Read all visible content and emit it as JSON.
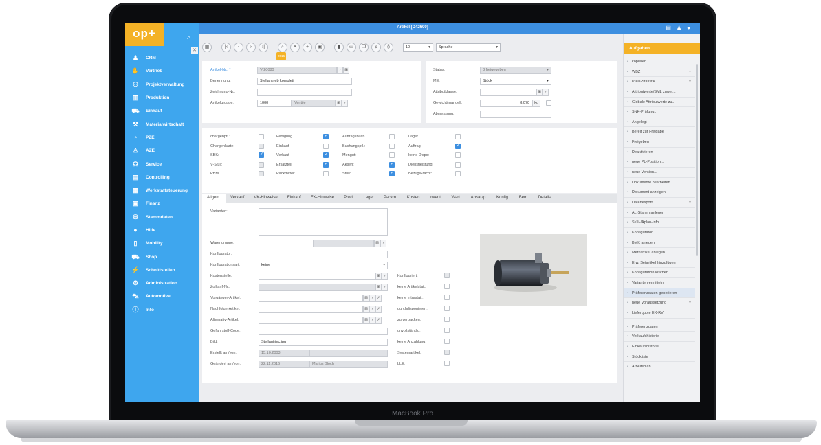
{
  "device": {
    "brand": "MacBook Pro"
  },
  "window": {
    "title": "Artikel [D42600]"
  },
  "logo": "op+",
  "sidebar": {
    "items": [
      {
        "label": "CRM",
        "icon": "people-icon"
      },
      {
        "label": "Vertrieb",
        "icon": "handshake-icon"
      },
      {
        "label": "Projektverwaltung",
        "icon": "org-chart-icon"
      },
      {
        "label": "Produktion",
        "icon": "factory-icon"
      },
      {
        "label": "Einkauf",
        "icon": "cart-icon"
      },
      {
        "label": "Materialwirtschaft",
        "icon": "forklift-icon"
      },
      {
        "label": "PZE",
        "icon": "clock-user-icon"
      },
      {
        "label": "AZE",
        "icon": "user-icon"
      },
      {
        "label": "Service",
        "icon": "headset-icon"
      },
      {
        "label": "Controlling",
        "icon": "chart-icon"
      },
      {
        "label": "Werkstattsteuerung",
        "icon": "grid-icon"
      },
      {
        "label": "Finanz",
        "icon": "calculator-icon"
      },
      {
        "label": "Stammdaten",
        "icon": "database-icon"
      },
      {
        "label": "Hilfe",
        "icon": "lightbulb-icon"
      },
      {
        "label": "Mobility",
        "icon": "phone-icon"
      },
      {
        "label": "Shop",
        "icon": "shop-cart-icon"
      },
      {
        "label": "Schnittstellen",
        "icon": "plug-icon"
      },
      {
        "label": "Administration",
        "icon": "admin-icon"
      },
      {
        "label": "Automotive",
        "icon": "car-icon"
      },
      {
        "label": "Info",
        "icon": "info-icon"
      }
    ]
  },
  "toolbar": {
    "year_badge": "2016",
    "size_value": "10",
    "language_value": "Sprache"
  },
  "header_form": {
    "artikel_label": "Artikel-Nr.: *",
    "artikel_value": "V-20080",
    "benennung_label": "Benennung:",
    "benennung_value": "Stellantrieb komplett",
    "zeichnung_label": "Zeichnung-Nr.:",
    "zeichnung_value": "",
    "artikelgruppe_label": "Artikelgruppe:",
    "artikelgruppe_value": "1000",
    "artikelgruppe_name": "Ventile",
    "status_label": "Status:",
    "status_value": "3 freigegeben",
    "me_label": "ME:",
    "me_value": "Stück",
    "attributklasse_label": "Attributklasse:",
    "attributklasse_value": "",
    "gewicht_label": "Gewicht/manuell:",
    "gewicht_value": "8,070",
    "gewicht_unit": "kg",
    "abmessung_label": "Abmessung:",
    "abmessung_value": ""
  },
  "flags": [
    {
      "label": "chargenpfl.:",
      "state": "off"
    },
    {
      "label": "Fertigung",
      "state": "on"
    },
    {
      "label": "Auftragsbuch.:",
      "state": "off"
    },
    {
      "label": "Lager",
      "state": "off"
    },
    {
      "label": "Chargenkarte:",
      "state": "dis"
    },
    {
      "label": "Einkauf",
      "state": "off"
    },
    {
      "label": "Buchungspfl.:",
      "state": "off"
    },
    {
      "label": "Auftrag",
      "state": "on"
    },
    {
      "label": "SBK:",
      "state": "on"
    },
    {
      "label": "Verkauf",
      "state": "on"
    },
    {
      "label": "Mengut:",
      "state": "off"
    },
    {
      "label": "keine Dispo:",
      "state": "off"
    },
    {
      "label": "V-Stüli:",
      "state": "dis"
    },
    {
      "label": "Ersatzteil",
      "state": "on"
    },
    {
      "label": "Aktien:",
      "state": "on"
    },
    {
      "label": "Dienstleistung:",
      "state": "off"
    },
    {
      "label": "PBM:",
      "state": "dis"
    },
    {
      "label": "Packmittel:",
      "state": "off"
    },
    {
      "label": "Stüli:",
      "state": "on"
    },
    {
      "label": "Bezug/Fracht:",
      "state": "off"
    }
  ],
  "tabs": [
    "Allgem.",
    "Verkauf",
    "VK-Hinweise",
    "Einkauf",
    "EK-Hinweise",
    "Prod.",
    "Lager",
    "Packm.",
    "Kosten",
    "Invent.",
    "Wart.",
    "Absatzp.",
    "Konfig.",
    "Bem.",
    "Details"
  ],
  "allgem": {
    "varianten_label": "Varianten:",
    "warengruppe_label": "Warengruppe:",
    "konfigurator_label": "Konfigurator:",
    "konfigurationsart_label": "Konfigurationsart:",
    "konfigurationsart_value": "keine",
    "kostenstelle_label": "Kostenstelle:",
    "zolltarif_label": "Zolltarif-Nr.:",
    "vorgaenger_label": "Vorgänger-Artikel:",
    "nachfolge_label": "Nachfolge-Artikel:",
    "alternativ_label": "Alternativ-Artikel:",
    "gefahrstoff_label": "Gefahrstoff-Code:",
    "bild_label": "Bild:",
    "bild_value": "Stellantriec.jpg",
    "erstellt_label": "Erstellt am/von:",
    "erstellt_value": "15.10.2003",
    "geaendert_label": "Geändert am/von:",
    "geaendert_value": "22.11.2016",
    "geaendert_user": "Marius Bloch",
    "checks": [
      {
        "label": "Konfiguriert:",
        "state": "dis"
      },
      {
        "label": "keine Artikelstat.:",
        "state": "off"
      },
      {
        "label": "keine Intrastat.:",
        "state": "off"
      },
      {
        "label": "durchdisponieren:",
        "state": "off"
      },
      {
        "label": "zu verpacken:",
        "state": "off"
      },
      {
        "label": "unvollständig:",
        "state": "off"
      },
      {
        "label": "keine Anzahlung:",
        "state": "off"
      },
      {
        "label": "Systemartikel:",
        "state": "dis"
      },
      {
        "label": "LLE:",
        "state": "off"
      }
    ]
  },
  "tasks": {
    "title": "Aufgaben",
    "items": [
      {
        "label": "kopieren..."
      },
      {
        "label": "WBZ",
        "chev": true
      },
      {
        "label": "Preis-Statistik",
        "chev": true
      },
      {
        "label": "Attributwerte/SML zuwei..."
      },
      {
        "label": "Globale Attributwerte zu..."
      },
      {
        "label": "SNK-Prüfung..."
      },
      {
        "label": "Angelegt"
      },
      {
        "label": "Bereit zur Freigabe"
      },
      {
        "label": "Freigeben"
      },
      {
        "label": "Deaktivieren"
      },
      {
        "label": "neue PL-Position..."
      },
      {
        "label": "neue Version..."
      },
      {
        "label": "Dokumente bearbeiten"
      },
      {
        "label": "Dokument anzeigen"
      },
      {
        "label": "Datenexport",
        "chev": true
      },
      {
        "label": "AL-Stamm anlegen"
      },
      {
        "label": "Stüli-/Aplan-Info..."
      },
      {
        "label": "Konfigurator..."
      },
      {
        "label": "BMK anlegen"
      },
      {
        "label": "Merkartikel anlegen..."
      },
      {
        "label": "Erw. Setartikel hinzufügen"
      },
      {
        "label": "Konfiguration löschen"
      },
      {
        "label": "Varianten ermitteln"
      },
      {
        "label": "Präferenzdaten generieren",
        "hl": true
      },
      {
        "label": "neue Voraussetzung",
        "chev": true
      },
      {
        "label": "Lieferquote EK-RV"
      },
      {
        "label": "Präferenzdaten",
        "gap": true
      },
      {
        "label": "Verkaufshistorie"
      },
      {
        "label": "Einkaufshistorie"
      },
      {
        "label": "Stückliste"
      },
      {
        "label": "Arbeitsplan"
      }
    ]
  }
}
